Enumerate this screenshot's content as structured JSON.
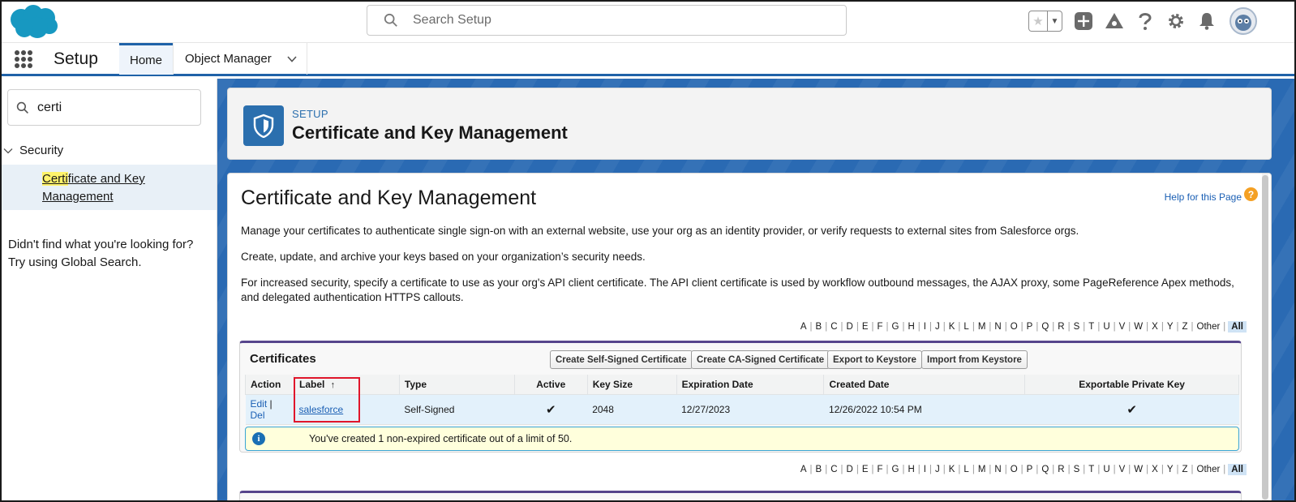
{
  "header": {
    "search_placeholder": "Search Setup",
    "icons": [
      "favorites-star-icon",
      "favorites-dropdown-icon",
      "global-actions-plus-icon",
      "trailhead-icon",
      "help-icon",
      "gear-icon",
      "notifications-bell-icon",
      "user-avatar"
    ]
  },
  "nav": {
    "app_name": "Setup",
    "tabs": [
      {
        "label": "Home",
        "active": true
      },
      {
        "label": "Object Manager",
        "active": false
      }
    ]
  },
  "sidebar": {
    "quick_find_value": "certi",
    "tree": {
      "parent": "Security",
      "child_match": "Certi",
      "child_rest_line1": "ficate and Key",
      "child_line2": "Management"
    },
    "not_found_line1": "Didn't find what you're looking for?",
    "not_found_line2": "Try using Global Search."
  },
  "page_header": {
    "eyebrow": "SETUP",
    "title": "Certificate and Key Management"
  },
  "content": {
    "title": "Certificate and Key Management",
    "help_link": "Help for this Page",
    "help_icon_glyph": "?",
    "descriptions": [
      "Manage your certificates to authenticate single sign-on with an external website, use your org as an identity provider, or verify requests to external sites from Salesforce orgs.",
      "Create, update, and archive your keys based on your organization’s security needs.",
      "For increased security, specify a certificate to use as your org's API client certificate. The API client certificate is used by workflow outbound messages, the AJAX proxy, some PageReference Apex methods, and delegated authentication HTTPS callouts."
    ],
    "alphabet": [
      "A",
      "B",
      "C",
      "D",
      "E",
      "F",
      "G",
      "H",
      "I",
      "J",
      "K",
      "L",
      "M",
      "N",
      "O",
      "P",
      "Q",
      "R",
      "S",
      "T",
      "U",
      "V",
      "W",
      "X",
      "Y",
      "Z",
      "Other"
    ],
    "alphabet_all": "All"
  },
  "certificates": {
    "title": "Certificates",
    "buttons": {
      "self_signed": "Create Self-Signed Certificate",
      "ca_signed": "Create CA-Signed Certificate",
      "export": "Export to Keystore",
      "import": "Import from Keystore"
    },
    "columns": {
      "action": "Action",
      "label": "Label",
      "sort_indicator": "↑",
      "type": "Type",
      "active": "Active",
      "key_size": "Key Size",
      "expiration": "Expiration Date",
      "created": "Created Date",
      "exportable": "Exportable Private Key"
    },
    "row": {
      "edit": "Edit",
      "separator": "|",
      "del": "Del",
      "label": "salesforce",
      "type": "Self-Signed",
      "active": "✔",
      "key_size": "2048",
      "expiration": "12/27/2023",
      "created": "12/26/2022 10:54 PM",
      "exportable": "✔"
    },
    "info_icon_glyph": "i",
    "info": "You've created 1 non-expired certificate out of a limit of 50."
  },
  "colors": {
    "brand_blue": "#1f62a8",
    "link_blue": "#1a5fb4",
    "block_accent": "#56458c",
    "highlight_box": "#e0162b"
  }
}
